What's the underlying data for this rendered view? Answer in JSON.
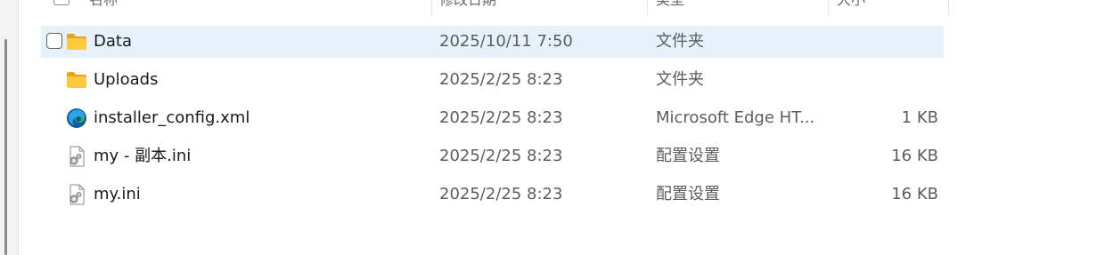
{
  "header": {
    "columns": {
      "name": "名称",
      "date": "修改日期",
      "type": "类型",
      "size": "大小"
    }
  },
  "files": [
    {
      "name": "Data",
      "date": "2025/10/11 7:50",
      "type": "文件夹",
      "size": "",
      "icon": "folder-icon",
      "selected": true
    },
    {
      "name": "Uploads",
      "date": "2025/2/25 8:23",
      "type": "文件夹",
      "size": "",
      "icon": "folder-icon"
    },
    {
      "name": "installer_config.xml",
      "date": "2025/2/25 8:23",
      "type": "Microsoft Edge HT...",
      "size": "1 KB",
      "icon": "edge-icon"
    },
    {
      "name": "my - 副本.ini",
      "date": "2025/2/25 8:23",
      "type": "配置设置",
      "size": "16 KB",
      "icon": "settings-file-icon"
    },
    {
      "name": "my.ini",
      "date": "2025/2/25 8:23",
      "type": "配置设置",
      "size": "16 KB",
      "icon": "settings-file-icon"
    }
  ],
  "colors": {
    "selection": "#e6f2fb",
    "folder": "#ffc83d",
    "edge_blue": "#0c59a4",
    "edge_green": "#3bb44a"
  }
}
